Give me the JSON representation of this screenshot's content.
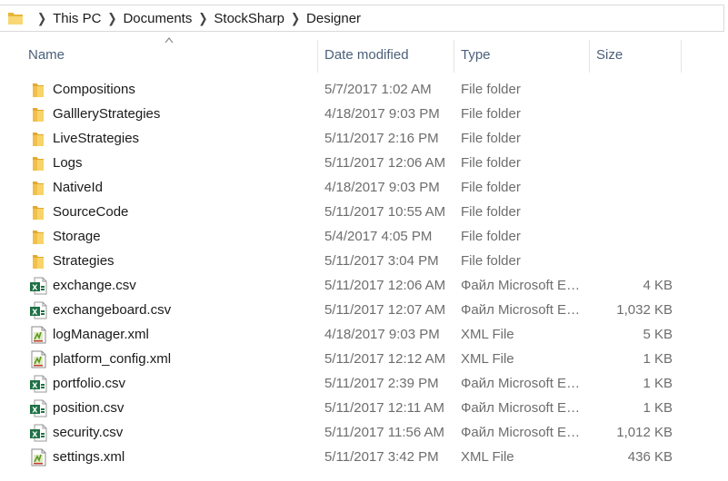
{
  "breadcrumb": [
    "This PC",
    "Documents",
    "StockSharp",
    "Designer"
  ],
  "columns": {
    "name": "Name",
    "date": "Date modified",
    "type": "Type",
    "size": "Size"
  },
  "files": [
    {
      "name": "Compositions",
      "date": "5/7/2017 1:02 AM",
      "type": "File folder",
      "size": "",
      "icon": "folder-icon"
    },
    {
      "name": "GallleryStrategies",
      "date": "4/18/2017 9:03 PM",
      "type": "File folder",
      "size": "",
      "icon": "folder-icon"
    },
    {
      "name": "LiveStrategies",
      "date": "5/11/2017 2:16 PM",
      "type": "File folder",
      "size": "",
      "icon": "folder-icon"
    },
    {
      "name": "Logs",
      "date": "5/11/2017 12:06 AM",
      "type": "File folder",
      "size": "",
      "icon": "folder-icon"
    },
    {
      "name": "NativeId",
      "date": "4/18/2017 9:03 PM",
      "type": "File folder",
      "size": "",
      "icon": "folder-icon"
    },
    {
      "name": "SourceCode",
      "date": "5/11/2017 10:55 AM",
      "type": "File folder",
      "size": "",
      "icon": "folder-icon"
    },
    {
      "name": "Storage",
      "date": "5/4/2017 4:05 PM",
      "type": "File folder",
      "size": "",
      "icon": "folder-icon"
    },
    {
      "name": "Strategies",
      "date": "5/11/2017 3:04 PM",
      "type": "File folder",
      "size": "",
      "icon": "folder-icon"
    },
    {
      "name": "exchange.csv",
      "date": "5/11/2017 12:06 AM",
      "type": "Файл Microsoft Excel",
      "size": "4 KB",
      "icon": "excel-csv-icon"
    },
    {
      "name": "exchangeboard.csv",
      "date": "5/11/2017 12:07 AM",
      "type": "Файл Microsoft Excel",
      "size": "1,032 KB",
      "icon": "excel-csv-icon"
    },
    {
      "name": "logManager.xml",
      "date": "4/18/2017 9:03 PM",
      "type": "XML File",
      "size": "5 KB",
      "icon": "xml-file-icon"
    },
    {
      "name": "platform_config.xml",
      "date": "5/11/2017 12:12 AM",
      "type": "XML File",
      "size": "1 KB",
      "icon": "xml-file-icon"
    },
    {
      "name": "portfolio.csv",
      "date": "5/11/2017 2:39 PM",
      "type": "Файл Microsoft Excel",
      "size": "1 KB",
      "icon": "excel-csv-icon"
    },
    {
      "name": "position.csv",
      "date": "5/11/2017 12:11 AM",
      "type": "Файл Microsoft Excel",
      "size": "1 KB",
      "icon": "excel-csv-icon"
    },
    {
      "name": "security.csv",
      "date": "5/11/2017 11:56 AM",
      "type": "Файл Microsoft Excel",
      "size": "1,012 KB",
      "icon": "excel-csv-icon"
    },
    {
      "name": "settings.xml",
      "date": "5/11/2017 3:42 PM",
      "type": "XML File",
      "size": "436 KB",
      "icon": "xml-file-icon"
    }
  ]
}
